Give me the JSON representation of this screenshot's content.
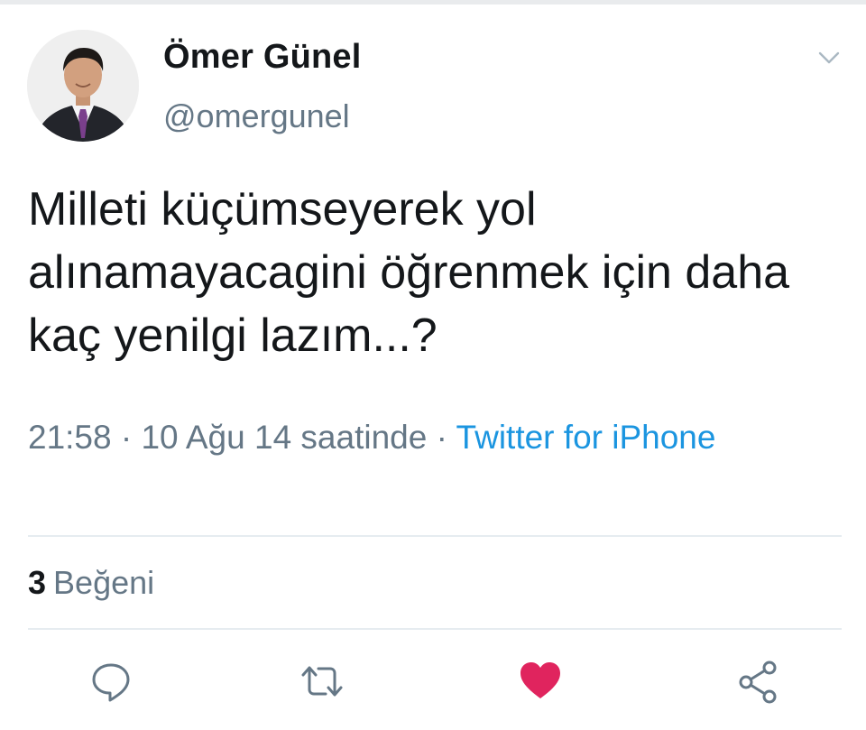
{
  "author": {
    "name": "Ömer Günel",
    "handle": "@omergunel"
  },
  "tweet": {
    "text": "Milleti küçümseyerek yol alınamayacagini öğrenmek için daha kaç yenilgi lazım...?"
  },
  "meta": {
    "time": "21:58",
    "sep1": " · ",
    "date": "10 Ağu 14 saatinde",
    "sep2": " · ",
    "source": "Twitter for iPhone"
  },
  "stats": {
    "likes_count": "3",
    "likes_label": "Beğeni"
  },
  "colors": {
    "text": "#14171a",
    "muted": "#657786",
    "link": "#1b95e0",
    "like": "#e0245e",
    "icon": "#657786"
  },
  "icons": {
    "menu": "chevron-down-icon",
    "reply": "reply-icon",
    "retweet": "retweet-icon",
    "like": "heart-icon",
    "share": "share-icon"
  }
}
